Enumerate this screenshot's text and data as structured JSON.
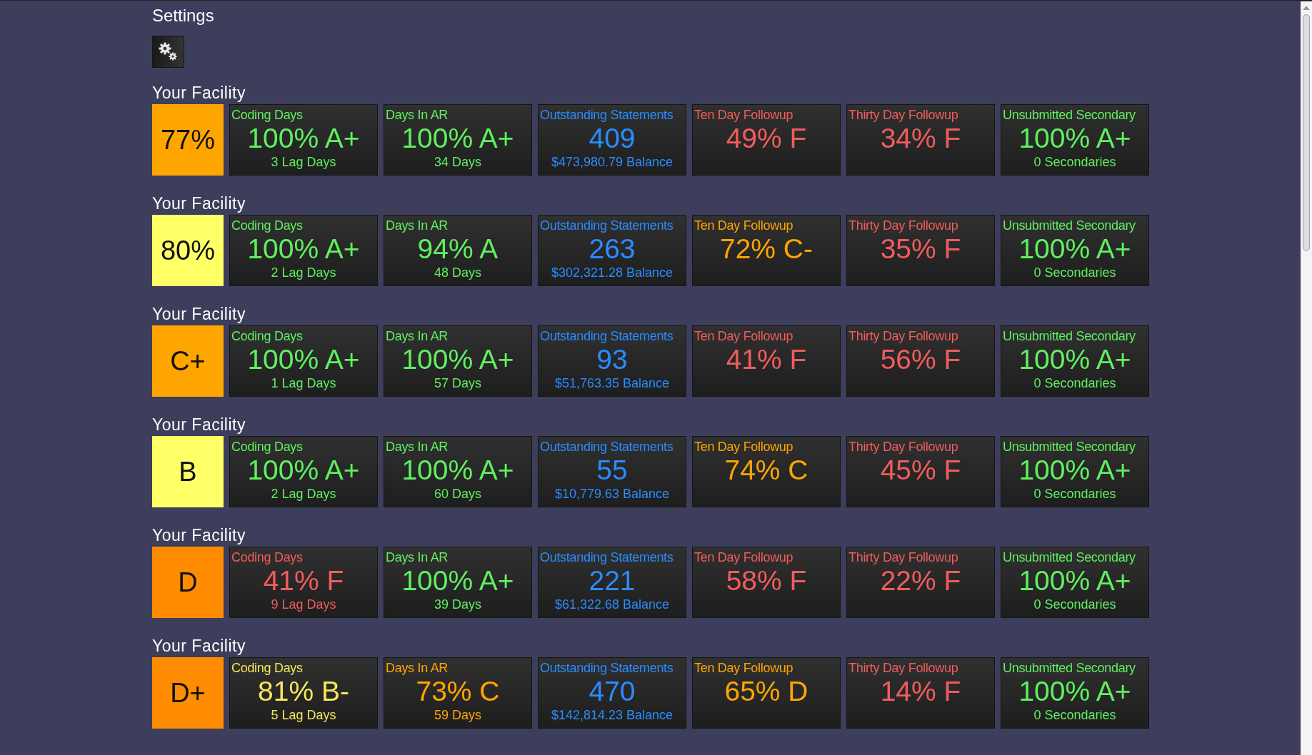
{
  "title": "Settings",
  "facilities": [
    {
      "name": "Your Facility",
      "score": {
        "text": "77%",
        "color": "#ffa500"
      },
      "tiles": [
        {
          "label": "Coding Days",
          "value": "100% A+",
          "detail": "3 Lag Days",
          "color": "#5ff05f"
        },
        {
          "label": "Days In AR",
          "value": "100% A+",
          "detail": "34 Days",
          "color": "#5ff05f"
        },
        {
          "label": "Outstanding Statements",
          "value": "409",
          "detail": "$473,980.79 Balance",
          "color": "#2a8cff"
        },
        {
          "label": "Ten Day Followup",
          "value": "49% F",
          "color": "#f25c5c"
        },
        {
          "label": "Thirty Day Followup",
          "value": "34% F",
          "color": "#f25c5c"
        },
        {
          "label": "Unsubmitted Secondary",
          "value": "100% A+",
          "detail": "0 Secondaries",
          "color": "#5ff05f"
        }
      ]
    },
    {
      "name": "Your Facility",
      "score": {
        "text": "80%",
        "color": "#ffff66"
      },
      "tiles": [
        {
          "label": "Coding Days",
          "value": "100% A+",
          "detail": "2 Lag Days",
          "color": "#5ff05f"
        },
        {
          "label": "Days In AR",
          "value": "94% A",
          "detail": "48 Days",
          "color": "#5ff05f"
        },
        {
          "label": "Outstanding Statements",
          "value": "263",
          "detail": "$302,321.28 Balance",
          "color": "#2a8cff"
        },
        {
          "label": "Ten Day Followup",
          "value": "72% C-",
          "color": "#ffa500"
        },
        {
          "label": "Thirty Day Followup",
          "value": "35% F",
          "color": "#f25c5c"
        },
        {
          "label": "Unsubmitted Secondary",
          "value": "100% A+",
          "detail": "0 Secondaries",
          "color": "#5ff05f"
        }
      ]
    },
    {
      "name": "Your Facility",
      "score": {
        "text": "C+",
        "color": "#ffa500"
      },
      "tiles": [
        {
          "label": "Coding Days",
          "value": "100% A+",
          "detail": "1 Lag Days",
          "color": "#5ff05f"
        },
        {
          "label": "Days In AR",
          "value": "100% A+",
          "detail": "57 Days",
          "color": "#5ff05f"
        },
        {
          "label": "Outstanding Statements",
          "value": "93",
          "detail": "$51,763.35 Balance",
          "color": "#2a8cff"
        },
        {
          "label": "Ten Day Followup",
          "value": "41% F",
          "color": "#f25c5c"
        },
        {
          "label": "Thirty Day Followup",
          "value": "56% F",
          "color": "#f25c5c"
        },
        {
          "label": "Unsubmitted Secondary",
          "value": "100% A+",
          "detail": "0 Secondaries",
          "color": "#5ff05f"
        }
      ]
    },
    {
      "name": "Your Facility",
      "score": {
        "text": "B",
        "color": "#ffff66"
      },
      "tiles": [
        {
          "label": "Coding Days",
          "value": "100% A+",
          "detail": "2 Lag Days",
          "color": "#5ff05f"
        },
        {
          "label": "Days In AR",
          "value": "100% A+",
          "detail": "60 Days",
          "color": "#5ff05f"
        },
        {
          "label": "Outstanding Statements",
          "value": "55",
          "detail": "$10,779.63 Balance",
          "color": "#2a8cff"
        },
        {
          "label": "Ten Day Followup",
          "value": "74% C",
          "color": "#ffa500"
        },
        {
          "label": "Thirty Day Followup",
          "value": "45% F",
          "color": "#f25c5c"
        },
        {
          "label": "Unsubmitted Secondary",
          "value": "100% A+",
          "detail": "0 Secondaries",
          "color": "#5ff05f"
        }
      ]
    },
    {
      "name": "Your Facility",
      "score": {
        "text": "D",
        "color": "#ff8c00"
      },
      "tiles": [
        {
          "label": "Coding Days",
          "value": "41% F",
          "detail": "9 Lag Days",
          "color": "#f25c5c"
        },
        {
          "label": "Days In AR",
          "value": "100% A+",
          "detail": "39 Days",
          "color": "#5ff05f"
        },
        {
          "label": "Outstanding Statements",
          "value": "221",
          "detail": "$61,322.68 Balance",
          "color": "#2a8cff"
        },
        {
          "label": "Ten Day Followup",
          "value": "58% F",
          "color": "#f25c5c"
        },
        {
          "label": "Thirty Day Followup",
          "value": "22% F",
          "color": "#f25c5c"
        },
        {
          "label": "Unsubmitted Secondary",
          "value": "100% A+",
          "detail": "0 Secondaries",
          "color": "#5ff05f"
        }
      ]
    },
    {
      "name": "Your Facility",
      "score": {
        "text": "D+",
        "color": "#ff8c00"
      },
      "tiles": [
        {
          "label": "Coding Days",
          "value": "81% B-",
          "detail": "5 Lag Days",
          "color": "#f5e65a"
        },
        {
          "label": "Days In AR",
          "value": "73% C",
          "detail": "59 Days",
          "color": "#ffa500"
        },
        {
          "label": "Outstanding Statements",
          "value": "470",
          "detail": "$142,814.23 Balance",
          "color": "#2a8cff"
        },
        {
          "label": "Ten Day Followup",
          "value": "65% D",
          "color": "#ffa500"
        },
        {
          "label": "Thirty Day Followup",
          "value": "14% F",
          "color": "#f25c5c"
        },
        {
          "label": "Unsubmitted Secondary",
          "value": "100% A+",
          "detail": "0 Secondaries",
          "color": "#5ff05f"
        }
      ]
    }
  ]
}
